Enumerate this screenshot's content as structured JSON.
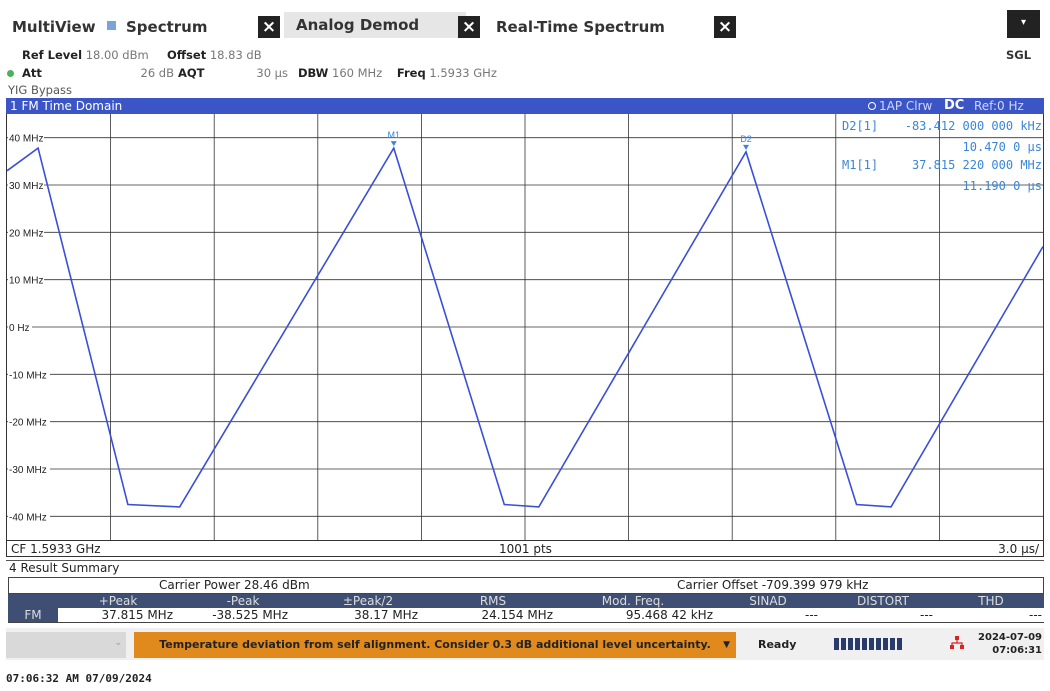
{
  "tabs": {
    "multiview": "MultiView",
    "spectrum": "Spectrum",
    "analog_demod": "Analog Demod",
    "realtime_spectrum": "Real-Time Spectrum",
    "close_glyph": "×",
    "menu_glyph": "▾"
  },
  "sgl": "SGL",
  "info": {
    "ref_level_label": "Ref Level",
    "ref_level_value": "18.00 dBm",
    "offset_label": "Offset",
    "offset_value": "18.83 dB",
    "att_label": "Att",
    "att_value": "26 dB",
    "aqt_label": "AQT",
    "aqt_value": "30 µs",
    "dbw_label": "DBW",
    "dbw_value": "160 MHz",
    "freq_label": "Freq",
    "freq_value": "1.5933 GHz",
    "yig": "YIG Bypass"
  },
  "diagram": {
    "title": "1 FM Time Domain",
    "trace_info": "1AP Clrw",
    "dc": "DC",
    "ref": "Ref:0 Hz",
    "y_ticks": [
      "40 MHz",
      "30 MHz",
      "20 MHz",
      "10 MHz",
      "0 Hz",
      "-10 MHz",
      "-20 MHz",
      "-30 MHz",
      "-40 MHz"
    ],
    "markers": {
      "d2_label": "D2[1]",
      "d2_value": "-83.412 000 000 kHz",
      "d2_time": "10.470 0 µs",
      "m1_label": "M1[1]",
      "m1_value": "37.815 220 000 MHz",
      "m1_time": "11.190 0 µs",
      "m1_tag": "M1",
      "d2_tag": "D2"
    },
    "cf": "CF 1.5933 GHz",
    "pts": "1001 pts",
    "div": "3.0 µs/"
  },
  "chart_data": {
    "type": "line",
    "ylim": [
      -45,
      45
    ],
    "y_unit": "MHz",
    "x_unit": "µs",
    "xlim": [
      0,
      30
    ],
    "grid": true,
    "series": [
      {
        "color": "#3a4fd8",
        "x": [
          0,
          0.9,
          3.5,
          5.0,
          11.2,
          14.4,
          15.4,
          21.4,
          24.6,
          25.6,
          30.0
        ],
        "y": [
          33,
          37.8,
          -37.5,
          -38.0,
          37.8,
          -37.5,
          -38.0,
          37.0,
          -37.5,
          -38.0,
          17.0
        ]
      }
    ]
  },
  "result_summary": {
    "title": "4 Result Summary",
    "carrier_power": "Carrier Power  28.46 dBm",
    "carrier_offset": "Carrier Offset  -709.399 979 kHz",
    "headers": [
      "+Peak",
      "-Peak",
      "±Peak/2",
      "RMS",
      "Mod. Freq.",
      "SINAD",
      "DISTORT",
      "THD"
    ],
    "row_label": "FM",
    "values": [
      "37.815 MHz",
      "-38.525 MHz",
      "38.17 MHz",
      "24.154 MHz",
      "95.468 42 kHz",
      "---",
      "---",
      "---"
    ]
  },
  "status": {
    "warning": "Temperature deviation from self alignment. Consider 0.3 dB additional level uncertainty.",
    "ready": "Ready",
    "date": "2024-07-09",
    "time": "07:06:31"
  },
  "timestamp": "07:06:32 AM  07/09/2024"
}
